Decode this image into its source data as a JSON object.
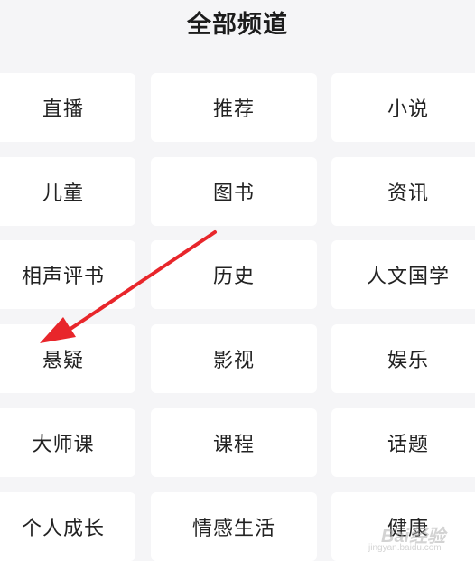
{
  "header": {
    "title": "全部频道"
  },
  "channels": [
    {
      "label": "直播"
    },
    {
      "label": "推荐"
    },
    {
      "label": "小说"
    },
    {
      "label": "儿童"
    },
    {
      "label": "图书"
    },
    {
      "label": "资讯"
    },
    {
      "label": "相声评书"
    },
    {
      "label": "历史"
    },
    {
      "label": "人文国学"
    },
    {
      "label": "悬疑"
    },
    {
      "label": "影视"
    },
    {
      "label": "娱乐"
    },
    {
      "label": "大师课"
    },
    {
      "label": "课程"
    },
    {
      "label": "话题"
    },
    {
      "label": "个人成长"
    },
    {
      "label": "情感生活"
    },
    {
      "label": "健康"
    }
  ],
  "annotation": {
    "arrow_color": "#e8262b",
    "arrow_target": "悬疑"
  },
  "watermark": {
    "brand": "Bai经验",
    "url": "jingyan.baidu.com"
  },
  "colors": {
    "background": "#f5f5f7",
    "tile": "#ffffff",
    "text": "#222222"
  }
}
